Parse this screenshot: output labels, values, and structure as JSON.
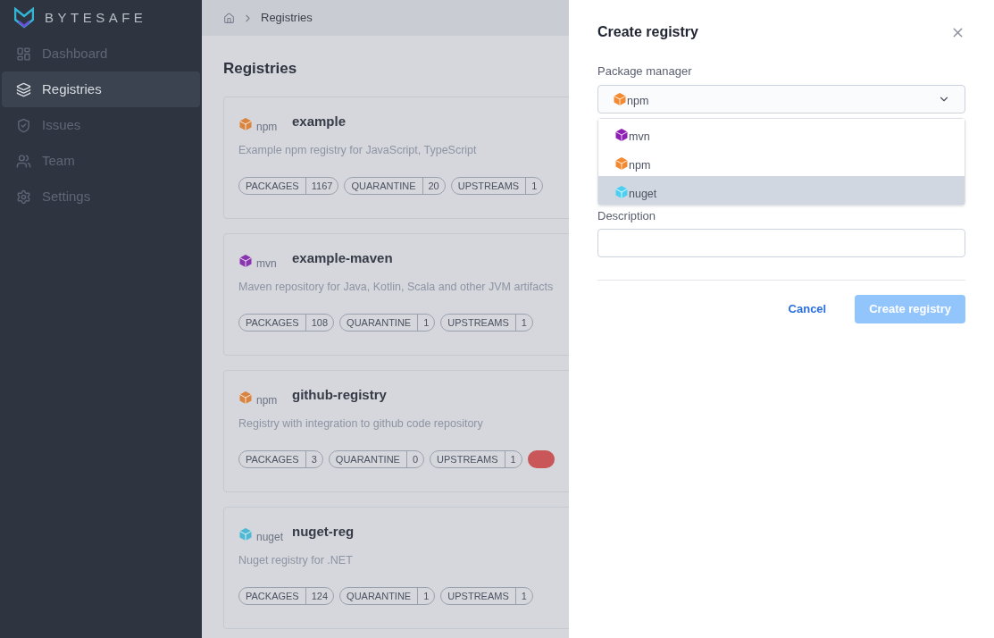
{
  "sidebar": {
    "brand": "BYTESAFE",
    "items": [
      {
        "label": "Dashboard",
        "selected": false
      },
      {
        "label": "Registries",
        "selected": true
      },
      {
        "label": "Issues",
        "selected": false
      },
      {
        "label": "Team",
        "selected": false
      },
      {
        "label": "Settings",
        "selected": false
      }
    ]
  },
  "breadcrumb": {
    "items": [
      "Registries"
    ]
  },
  "page_title": "Registries",
  "registries": [
    {
      "type": "npm",
      "color": "#d9843f",
      "name": "example",
      "description": "Example npm registry for JavaScript, TypeScript",
      "stats": [
        {
          "label": "PACKAGES",
          "value": "1167"
        },
        {
          "label": "QUARANTINE",
          "value": "20"
        },
        {
          "label": "UPSTREAMS",
          "value": "1"
        }
      ],
      "alert": false
    },
    {
      "type": "mvn",
      "color": "#8a35b0",
      "name": "example-maven",
      "description": "Maven repository for Java, Kotlin, Scala and other JVM artifacts",
      "stats": [
        {
          "label": "PACKAGES",
          "value": "108"
        },
        {
          "label": "QUARANTINE",
          "value": "1"
        },
        {
          "label": "UPSTREAMS",
          "value": "1"
        }
      ],
      "alert": false
    },
    {
      "type": "npm",
      "color": "#d9843f",
      "name": "github-registry",
      "description": "Registry with integration to github code repository",
      "stats": [
        {
          "label": "PACKAGES",
          "value": "3"
        },
        {
          "label": "QUARANTINE",
          "value": "0"
        },
        {
          "label": "UPSTREAMS",
          "value": "1"
        }
      ],
      "alert": true
    },
    {
      "type": "nuget",
      "color": "#4fb8d4",
      "name": "nuget-reg",
      "description": "Nuget registry for .NET",
      "stats": [
        {
          "label": "PACKAGES",
          "value": "124"
        },
        {
          "label": "QUARANTINE",
          "value": "1"
        },
        {
          "label": "UPSTREAMS",
          "value": "1"
        }
      ],
      "alert": false
    }
  ],
  "drawer": {
    "title": "Create registry",
    "package_manager": {
      "label": "Package manager",
      "value": "npm",
      "expanded": true,
      "options": [
        {
          "label": "mvn",
          "color": "#8e1fb3",
          "highlighted": false
        },
        {
          "label": "npm",
          "color": "#f38a31",
          "highlighted": false
        },
        {
          "label": "nuget",
          "color": "#4dd0f0",
          "highlighted": true
        }
      ]
    },
    "description": {
      "label": "Description"
    },
    "buttons": [
      {
        "label": "Cancel",
        "kind": "link"
      },
      {
        "label": "Create registry",
        "kind": "primary",
        "disabled": true
      }
    ]
  }
}
